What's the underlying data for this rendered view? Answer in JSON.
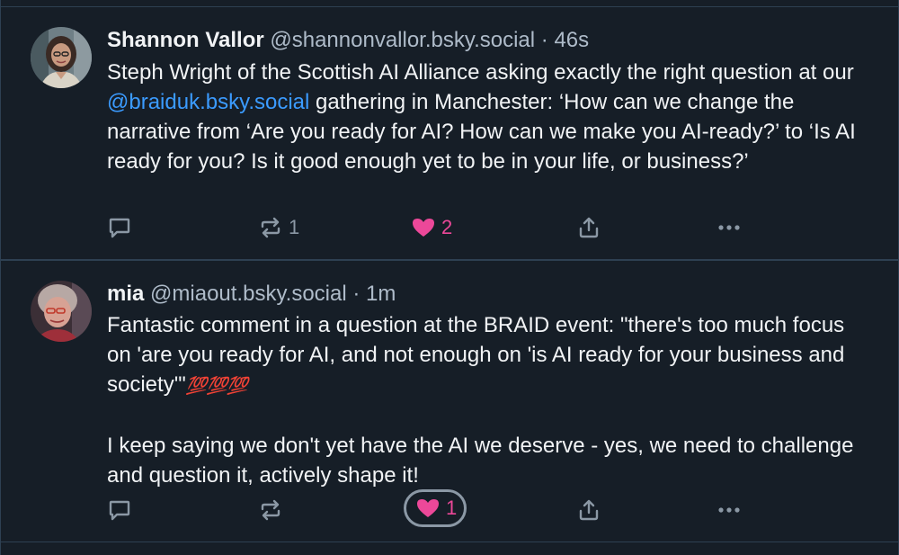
{
  "posts": [
    {
      "author_name": "Shannon Vallor",
      "handle": "@shannonvallor.bsky.social",
      "time": "46s",
      "text_before": "Steph Wright of the Scottish AI Alliance asking exactly the right question at our ",
      "mention": "@braiduk.bsky.social",
      "text_after": " gathering in Manchester: ‘How can we change the narrative from ‘Are you ready for AI? How can we make you AI-ready?’ to ‘Is AI ready for you? Is it good enough yet to be in your life, or business?’",
      "repost_count": "1",
      "like_count": "2",
      "liked": true
    },
    {
      "author_name": "mia",
      "handle": "@miaout.bsky.social",
      "time": "1m",
      "text_main": "Fantastic comment in a question at the BRAID event: \"there's too much focus on 'are you ready for AI, and not enough on 'is AI ready for your business and society'\"",
      "emoji": "💯💯💯",
      "text_second": "I keep saying we don't yet have the AI we deserve - yes, we need to challenge and question it, actively shape it!",
      "repost_count": "",
      "like_count": "1",
      "liked": true
    }
  ],
  "separator": " · ",
  "icons": {
    "reply": "reply-icon",
    "repost": "repost-icon",
    "like": "heart-icon",
    "share": "share-icon",
    "more": "more-icon"
  },
  "colors": {
    "background": "#161e27",
    "text": "#f1f3f5",
    "muted": "#aebbc9",
    "mention": "#3b9bff",
    "like": "#ec4899",
    "border": "#2e4052"
  }
}
